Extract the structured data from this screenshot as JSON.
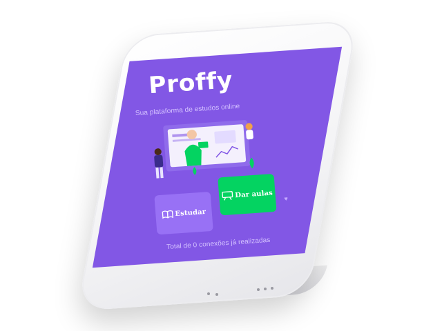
{
  "app": {
    "logo_text": "Proffy",
    "subtitle": "Sua plataforma de estudos online"
  },
  "actions": {
    "study_label": "Estudar",
    "teach_label": "Dar aulas"
  },
  "footer": {
    "connections_text": "Total de 0 conexões já realizadas",
    "heart_icon": "purple-heart-icon"
  },
  "colors": {
    "background": "#8257e5",
    "study_button": "#9871f5",
    "teach_button": "#04d361",
    "text_light": "#d4c2ff"
  },
  "icons": {
    "study": "open-book-icon",
    "teach": "presentation-board-icon"
  }
}
